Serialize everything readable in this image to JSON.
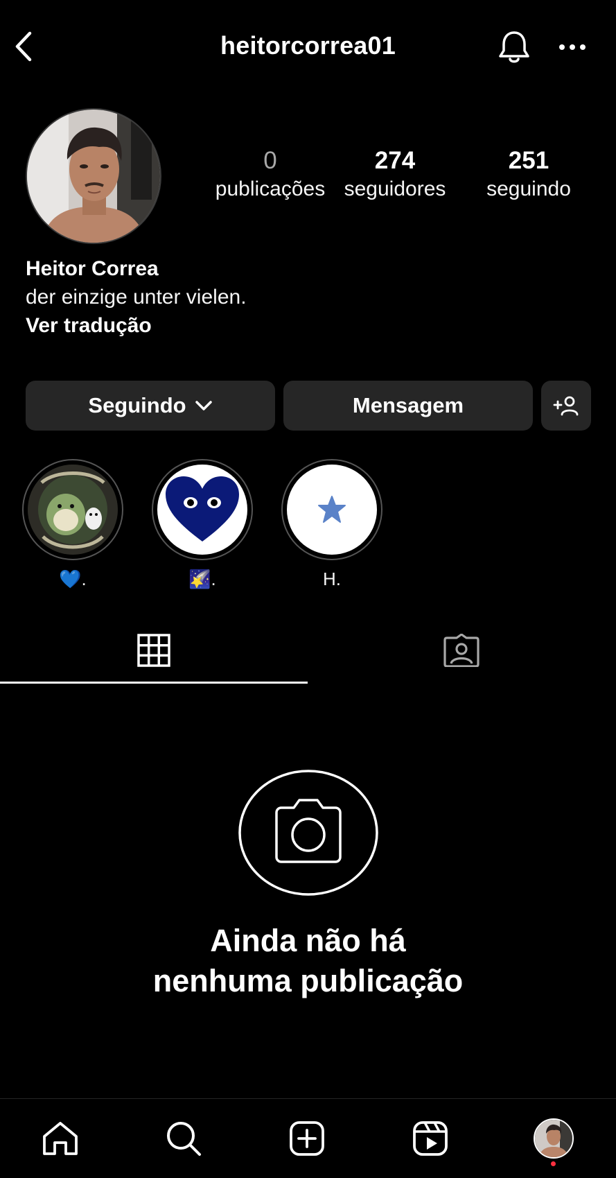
{
  "header": {
    "username": "heitorcorrea01",
    "back_icon": "chevron-left-icon",
    "bell_icon": "bell-icon",
    "more_icon": "more-horizontal-icon"
  },
  "profile": {
    "stats": [
      {
        "value": "0",
        "label": "publicações"
      },
      {
        "value": "274",
        "label": "seguidores"
      },
      {
        "value": "251",
        "label": "seguindo"
      }
    ],
    "name": "Heitor Correa",
    "bio": "der einzige unter vielen.",
    "translate_label": "Ver tradução"
  },
  "actions": {
    "following_label": "Seguindo",
    "message_label": "Mensagem",
    "add_person_icon": "add-person-icon"
  },
  "highlights": [
    {
      "label": "💙."
    },
    {
      "label": "🌠."
    },
    {
      "label": "H."
    }
  ],
  "tabs": [
    {
      "icon": "grid-icon",
      "active": true
    },
    {
      "icon": "tagged-user-icon",
      "active": false
    }
  ],
  "empty_state": {
    "title_line1": "Ainda não há",
    "title_line2": "nenhuma publicação"
  },
  "bottom_nav": [
    {
      "icon": "home-icon"
    },
    {
      "icon": "search-icon"
    },
    {
      "icon": "create-post-icon"
    },
    {
      "icon": "reels-icon"
    },
    {
      "icon": "profile-avatar"
    }
  ],
  "colors": {
    "background": "#000000",
    "button": "#262626",
    "notification_dot": "#ff3040",
    "heart_navy": "#0b1a78",
    "star_blue": "#5a82c8"
  }
}
